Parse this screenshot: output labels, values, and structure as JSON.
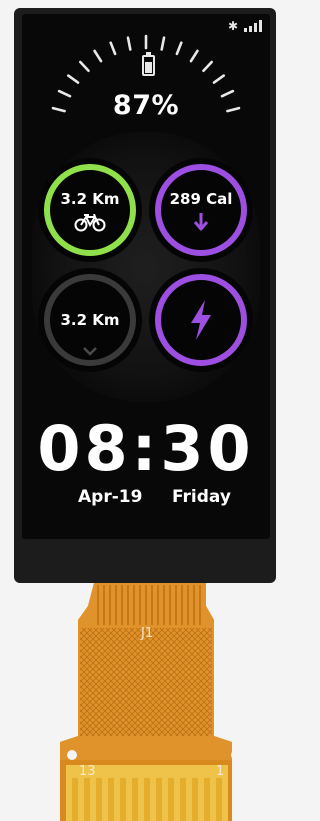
{
  "status": {
    "bluetooth_icon": "bluetooth-icon",
    "signal_icon": "signal-bars-icon"
  },
  "battery": {
    "percent_label": "87%",
    "level": 0.87
  },
  "tiles": [
    {
      "label": "3.2 Km",
      "icon": "bicycle-icon",
      "color": "#8fe04a"
    },
    {
      "label": "289 Cal",
      "icon": "arrow-down-icon",
      "color": "#9c4fe0"
    },
    {
      "label": "3.2 Km",
      "icon": "chevron-down-icon",
      "color": "#3a3a3a"
    },
    {
      "label": "",
      "icon": "lightning-icon",
      "color": "#9c4fe0"
    }
  ],
  "clock": {
    "time": "08:30",
    "date": "Apr-19",
    "weekday": "Friday"
  },
  "fpc": {
    "connector_label": "J1",
    "pin_left": "13",
    "pin_right": "1"
  },
  "colors": {
    "screen_bg": "#080808",
    "module_bezel": "#1c1c1c",
    "fpc_orange": "#d98a1e",
    "fpc_gold": "#efc24a"
  }
}
